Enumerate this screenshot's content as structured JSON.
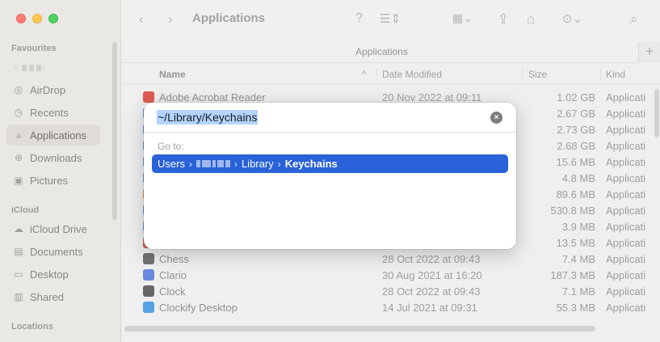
{
  "sidebar": {
    "favourites_title": "Favourites",
    "items": [
      {
        "label": "AirDrop",
        "icon": "airdrop-icon"
      },
      {
        "label": "Recents",
        "icon": "clock-icon"
      },
      {
        "label": "Applications",
        "icon": "applications-icon",
        "active": true
      },
      {
        "label": "Downloads",
        "icon": "downloads-icon"
      },
      {
        "label": "Pictures",
        "icon": "pictures-icon"
      }
    ],
    "icloud_title": "iCloud",
    "icloud_items": [
      {
        "label": "iCloud Drive",
        "icon": "cloud-icon"
      },
      {
        "label": "Documents",
        "icon": "document-icon"
      },
      {
        "label": "Desktop",
        "icon": "desktop-icon"
      },
      {
        "label": "Shared",
        "icon": "shared-folder-icon"
      }
    ],
    "locations_title": "Locations"
  },
  "toolbar": {
    "title": "Applications"
  },
  "pathbar": {
    "label": "Applications"
  },
  "columns": {
    "name": "Name",
    "date": "Date Modified",
    "size": "Size",
    "kind": "Kind"
  },
  "rows": [
    {
      "name": "Adobe Acrobat Reader",
      "date": "20 Nov 2022 at 09:11",
      "size": "1.02 GB",
      "kind": "Applicati",
      "color": "#d9362b"
    },
    {
      "name": "",
      "date": "",
      "size": "2.67 GB",
      "kind": "Applicati",
      "color": "#3b7dd8"
    },
    {
      "name": "",
      "date": "",
      "size": "2.73 GB",
      "kind": "Applicati",
      "color": "#3b7dd8"
    },
    {
      "name": "",
      "date": "",
      "size": "2.68 GB",
      "kind": "Applicati",
      "color": "#3b7dd8"
    },
    {
      "name": "",
      "date": "",
      "size": "15.6 MB",
      "kind": "Applicati",
      "color": "#3b7dd8"
    },
    {
      "name": "",
      "date": "",
      "size": "4.8 MB",
      "kind": "Applicati",
      "color": "#3b7dd8"
    },
    {
      "name": "",
      "date": "",
      "size": "89.6 MB",
      "kind": "Applicati",
      "color": "#e07b1e"
    },
    {
      "name": "",
      "date": "",
      "size": "530.8 MB",
      "kind": "Applicati",
      "color": "#3b7dd8"
    },
    {
      "name": "",
      "date": "",
      "size": "3.9 MB",
      "kind": "Applicati",
      "color": "#3b7dd8"
    },
    {
      "name": "",
      "date": "",
      "size": "13.5 MB",
      "kind": "Applicati",
      "color": "#c0392b"
    },
    {
      "name": "Chess",
      "date": "28 Oct 2022 at 09:43",
      "size": "7.4 MB",
      "kind": "Applicati",
      "color": "#555555"
    },
    {
      "name": "Clario",
      "date": "30 Aug 2021 at 16:20",
      "size": "187.3 MB",
      "kind": "Applicati",
      "color": "#4a6fd8"
    },
    {
      "name": "Clock",
      "date": "28 Oct 2022 at 09:43",
      "size": "7.1 MB",
      "kind": "Applicati",
      "color": "#444444"
    },
    {
      "name": "Clockify Desktop",
      "date": "14 Jul 2021 at 09:31",
      "size": "55.3 MB",
      "kind": "Applicati",
      "color": "#2d8ee0"
    }
  ],
  "dialog": {
    "path_value": "~/Library/Keychains",
    "goto_label": "Go to:",
    "suggestion": {
      "part1": "Users",
      "sep": "›",
      "part3": "Library",
      "part4": "Keychains"
    }
  }
}
